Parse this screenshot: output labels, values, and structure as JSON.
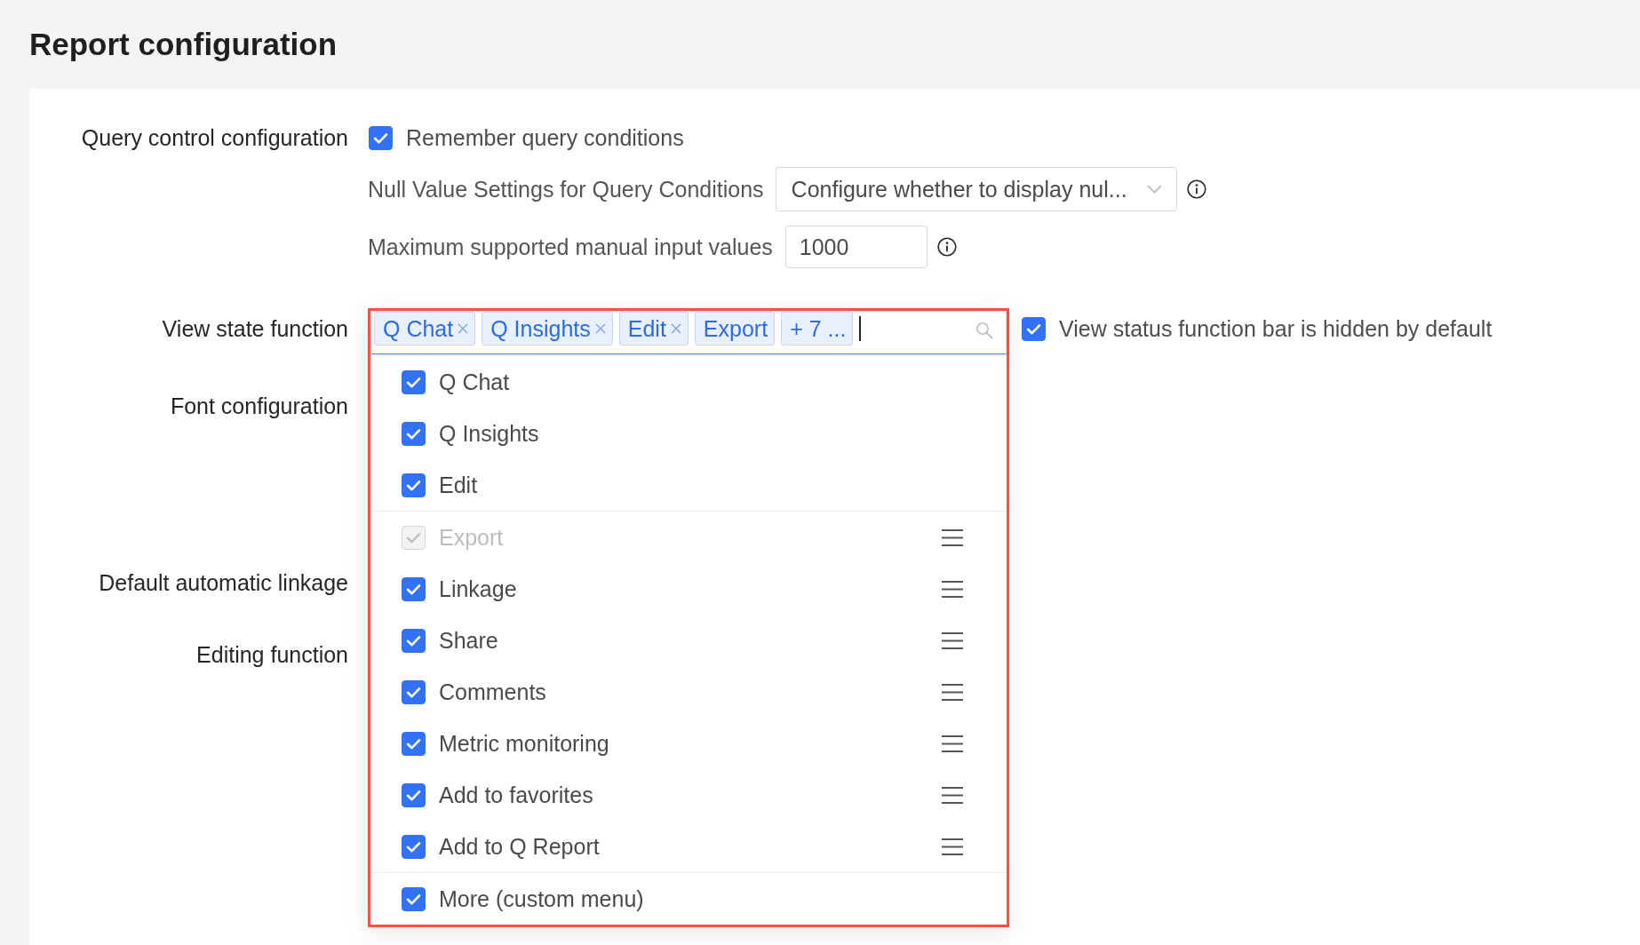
{
  "page_title": "Report configuration",
  "query_control": {
    "label": "Query control configuration",
    "remember": {
      "label": "Remember query conditions",
      "checked": true
    },
    "null_value": {
      "label": "Null Value Settings for Query Conditions",
      "value": "Configure whether to display nul..."
    },
    "max_input": {
      "label": "Maximum supported manual input values",
      "value": "1000"
    }
  },
  "view_state": {
    "label": "View state function",
    "focused": true,
    "tags": [
      {
        "text": "Q Chat",
        "removable": true
      },
      {
        "text": "Q Insights",
        "removable": true
      },
      {
        "text": "Edit",
        "removable": true
      },
      {
        "text": "Export",
        "removable": false
      },
      {
        "text": "+ 7 ...",
        "removable": false
      }
    ],
    "options": [
      {
        "label": "Q Chat",
        "kind": "fixed",
        "checked": true,
        "disabled": false
      },
      {
        "label": "Q Insights",
        "kind": "fixed",
        "checked": true,
        "disabled": false
      },
      {
        "label": "Edit",
        "kind": "fixed",
        "checked": true,
        "disabled": false
      },
      {
        "label": "Export",
        "kind": "sortable",
        "checked": true,
        "disabled": true
      },
      {
        "label": "Linkage",
        "kind": "sortable",
        "checked": true,
        "disabled": false
      },
      {
        "label": "Share",
        "kind": "sortable",
        "checked": true,
        "disabled": false
      },
      {
        "label": "Comments",
        "kind": "sortable",
        "checked": true,
        "disabled": false
      },
      {
        "label": "Metric monitoring",
        "kind": "sortable",
        "checked": true,
        "disabled": false
      },
      {
        "label": "Add to favorites",
        "kind": "sortable",
        "checked": true,
        "disabled": false
      },
      {
        "label": "Add to Q Report",
        "kind": "sortable",
        "checked": true,
        "disabled": false
      },
      {
        "label": "More (custom menu)",
        "kind": "fixed",
        "checked": true,
        "disabled": false
      }
    ],
    "hide_bar": {
      "label": "View status function bar is hidden by default",
      "checked": true
    }
  },
  "other_labels": [
    "Font configuration",
    "Default automatic linkage",
    "Editing function"
  ]
}
